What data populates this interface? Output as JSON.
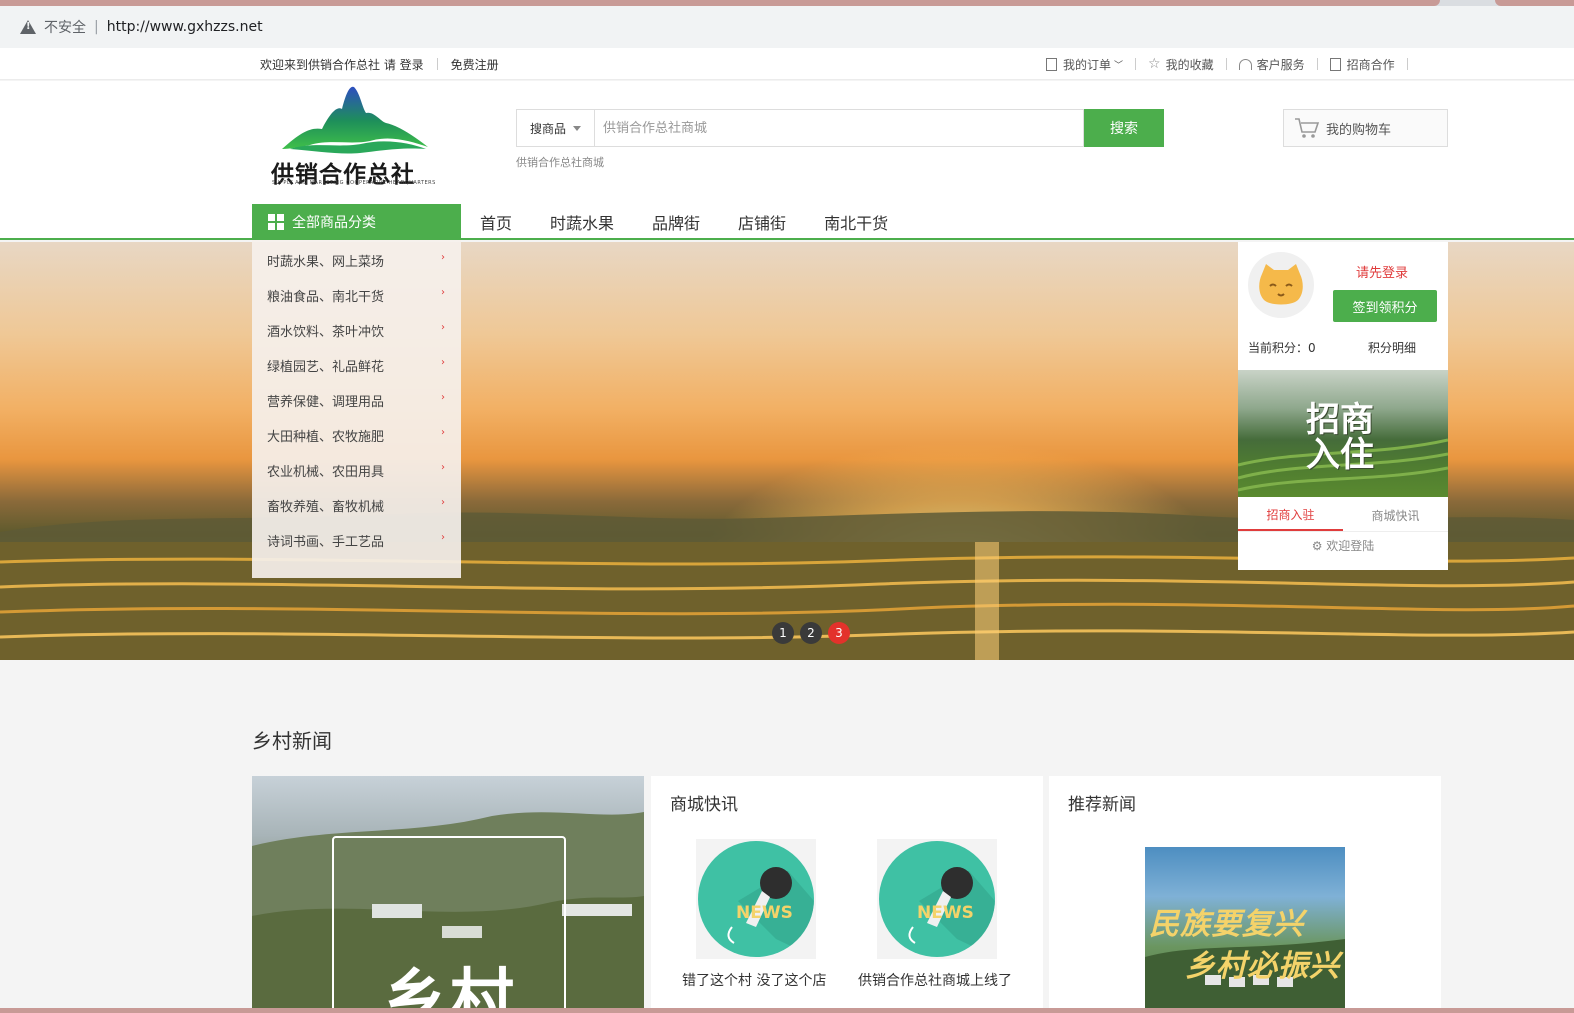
{
  "browser": {
    "security_label": "不安全",
    "url": "http://www.gxhzzs.net"
  },
  "topbar": {
    "welcome": "欢迎来到供销合作总社 请 登录",
    "register": "免费注册",
    "my_orders": "我的订单",
    "my_favorites": "我的收藏",
    "customer_service": "客户服务",
    "merchant": "招商合作"
  },
  "header": {
    "logo_text": "供销合作总社",
    "logo_sub": "SUPPLY AND MARKETING COOPERATIVE HEADQUARTERS",
    "search_category": "搜商品",
    "search_placeholder": "供销合作总社商城",
    "search_button": "搜索",
    "hot_keyword": "供销合作总社商城",
    "cart": "我的购物车"
  },
  "nav": {
    "all_categories": "全部商品分类",
    "links": [
      "首页",
      "时蔬水果",
      "品牌街",
      "店铺街",
      "南北干货"
    ]
  },
  "categories": [
    "时蔬水果、网上菜场",
    "粮油食品、南北干货",
    "酒水饮料、茶叶冲饮",
    "绿植园艺、礼品鲜花",
    "营养保健、调理用品",
    "大田种植、农牧施肥",
    "农业机械、农田用具",
    "畜牧养殖、畜牧机械",
    "诗词书画、手工艺品"
  ],
  "banner": {
    "pages": [
      "1",
      "2",
      "3"
    ],
    "active_page": "3"
  },
  "user_panel": {
    "login_tip": "请先登录",
    "sign_button": "签到领积分",
    "points": "当前积分：0",
    "points_detail": "积分明细",
    "promo_line1": "招商",
    "promo_line2": "入住",
    "tab_join": "招商入驻",
    "tab_news": "商城快讯",
    "welcome": "欢迎登陆"
  },
  "news": {
    "section_title": "乡村新闻",
    "feature_text": "乡村",
    "mall_news_title": "商城快讯",
    "mall_news": [
      {
        "caption": "错了这个村 没了这个店",
        "thumb_label": "NEWS"
      },
      {
        "caption": "供销合作总社商城上线了",
        "thumb_label": "NEWS"
      }
    ],
    "recommend_title": "推荐新闻",
    "recommend_line1": "民族要复兴",
    "recommend_line2": "乡村必振兴"
  },
  "colors": {
    "brand_green": "#4cae4c",
    "accent_red": "#e03c3c"
  }
}
